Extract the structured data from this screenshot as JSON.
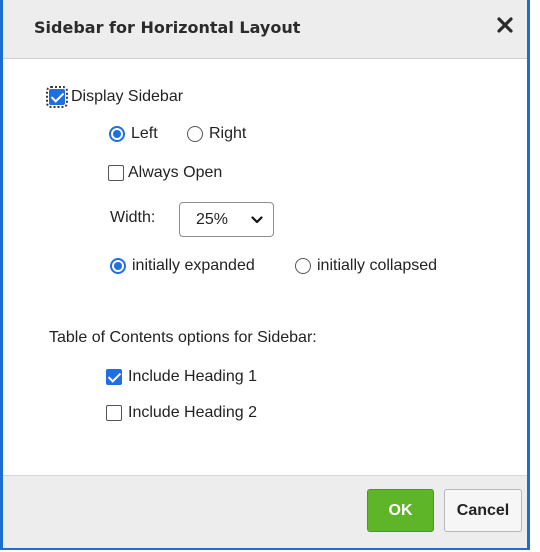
{
  "dialog": {
    "title": "Sidebar for Horizontal Layout",
    "close_icon": "close-x-icon"
  },
  "display_sidebar": {
    "label": "Display Sidebar",
    "checked": true
  },
  "position": {
    "left_label": "Left",
    "right_label": "Right",
    "selected": "Left"
  },
  "always_open": {
    "label": "Always Open",
    "checked": false
  },
  "width": {
    "label": "Width:",
    "value": "25%"
  },
  "initial_state": {
    "expanded_label": "initially expanded",
    "collapsed_label": "initially collapsed",
    "selected": "initially expanded"
  },
  "toc": {
    "heading": "Table of Contents options for Sidebar:",
    "heading1": {
      "label": "Include Heading 1",
      "checked": true
    },
    "heading2": {
      "label": "Include Heading 2",
      "checked": false
    }
  },
  "footer": {
    "ok_label": "OK",
    "cancel_label": "Cancel"
  },
  "colors": {
    "accent": "#1f6fe0",
    "border": "#1c6fd1",
    "ok_button": "#5fb528"
  }
}
